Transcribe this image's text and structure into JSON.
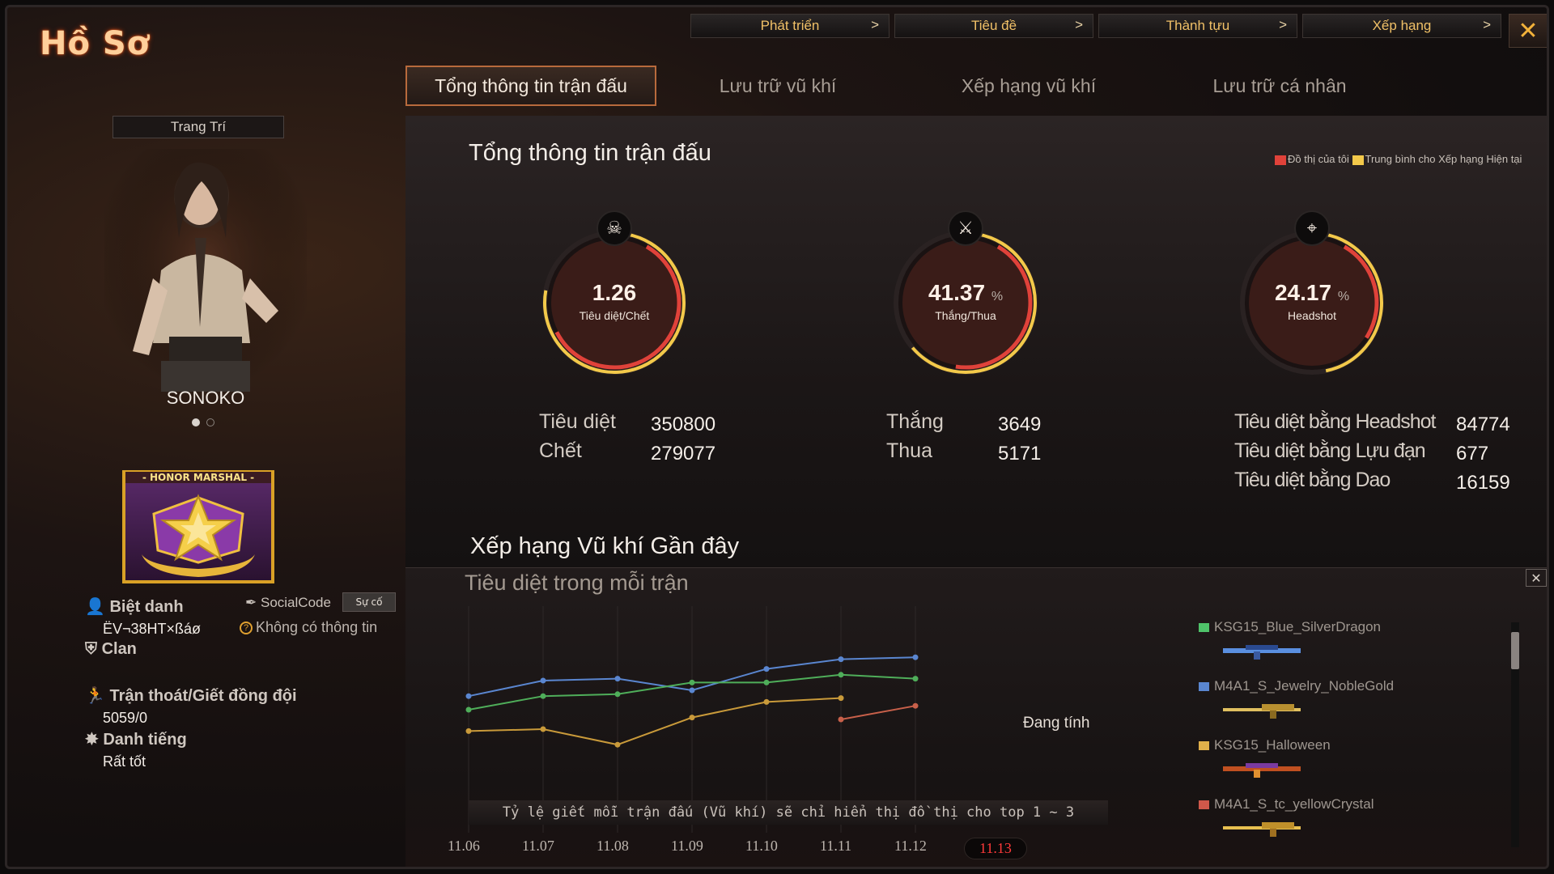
{
  "window": {
    "title": "Hồ Sơ"
  },
  "top_nav": [
    {
      "label": "Phát triển"
    },
    {
      "label": "Tiêu đề"
    },
    {
      "label": "Thành tựu"
    },
    {
      "label": "Xếp hạng"
    }
  ],
  "tabs": [
    {
      "label": "Tổng thông tin trận đấu",
      "active": true
    },
    {
      "label": "Lưu trữ vũ khí",
      "active": false
    },
    {
      "label": "Xếp hạng vũ khí",
      "active": false
    },
    {
      "label": "Lưu trữ cá nhân",
      "active": false
    }
  ],
  "profile": {
    "decorate_label": "Trang Trí",
    "character_name": "SONOKO",
    "badge_text": "- HONOR MARSHAL -",
    "nickname_label": "Biệt danh",
    "nickname_value": "ËV¬38HT×ßáø",
    "social_code_label": "SocialCode",
    "social_code_button": "Sự cố",
    "social_code_value": "Không có thông tin",
    "clan_label": "Clan",
    "quit_label": "Trận thoát/Giết đồng đội",
    "quit_value": "5059/0",
    "reputation_label": "Danh tiếng",
    "reputation_value": "Rất tốt"
  },
  "summary": {
    "title": "Tổng thông tin trận đấu",
    "legend_mine": "Đồ thị của tôi",
    "legend_avg": "Trung bình cho Xếp hạng Hiện tại",
    "legend_colors": {
      "mine": "#e0423a",
      "avg": "#f3c94a"
    },
    "gauges": [
      {
        "value": "1.26",
        "unit": "",
        "label": "Tiêu diệt/Chết",
        "icon": "skull-icon",
        "fill": 0.55
      },
      {
        "value": "41.37",
        "unit": "%",
        "label": "Thắng/Thua",
        "icon": "crossed-swords-icon",
        "fill": 0.41
      },
      {
        "value": "24.17",
        "unit": "%",
        "label": "Headshot",
        "icon": "crosshair-icon",
        "fill": 0.24
      }
    ],
    "stats": {
      "kills_label": "Tiêu diệt",
      "kills": "350800",
      "deaths_label": "Chết",
      "deaths": "279077",
      "wins_label": "Thắng",
      "wins": "3649",
      "losses_label": "Thua",
      "losses": "5171",
      "hs_label": "Tiêu diệt bằng Headshot",
      "hs": "84774",
      "grenade_label": "Tiêu diệt bằng Lựu đạn",
      "grenade": "677",
      "knife_label": "Tiêu diệt bằng Dao",
      "knife": "16159"
    }
  },
  "weapons_section": {
    "title": "Xếp hạng Vũ khí Gần đây",
    "subtitle": "Tiêu diệt trong mỗi trận",
    "calculating": "Đang tính",
    "note": "Tỷ lệ giết mỗi trận đấu (Vũ khí) sẽ chỉ hiển thị đồ thị cho top 1 ~ 3",
    "selected_date": "11.13"
  },
  "chart_data": {
    "type": "line",
    "categories": [
      "11.06",
      "11.07",
      "11.08",
      "11.09",
      "11.10",
      "11.11",
      "11.12",
      "11.13"
    ],
    "ylim": [
      0,
      10
    ],
    "series": [
      {
        "name": "KSG15_Blue_SilverDragon",
        "color": "#5a86d0",
        "values": [
          6.2,
          7.0,
          7.1,
          6.5,
          7.6,
          8.1,
          8.2,
          null
        ]
      },
      {
        "name": "M4A1_S_Jewelry_NobleGold",
        "color": "#4fae5a",
        "values": [
          5.5,
          6.2,
          6.3,
          6.9,
          6.9,
          7.3,
          7.1,
          null
        ]
      },
      {
        "name": "KSG15_Halloween",
        "color": "#c99a3a",
        "values": [
          4.4,
          4.5,
          3.7,
          5.1,
          5.9,
          6.1,
          null,
          null
        ]
      },
      {
        "name": "M4A1_S_tc_yellowCrystal",
        "color": "#c8604a",
        "values": [
          null,
          null,
          null,
          null,
          null,
          5.0,
          5.7,
          null
        ]
      }
    ]
  }
}
